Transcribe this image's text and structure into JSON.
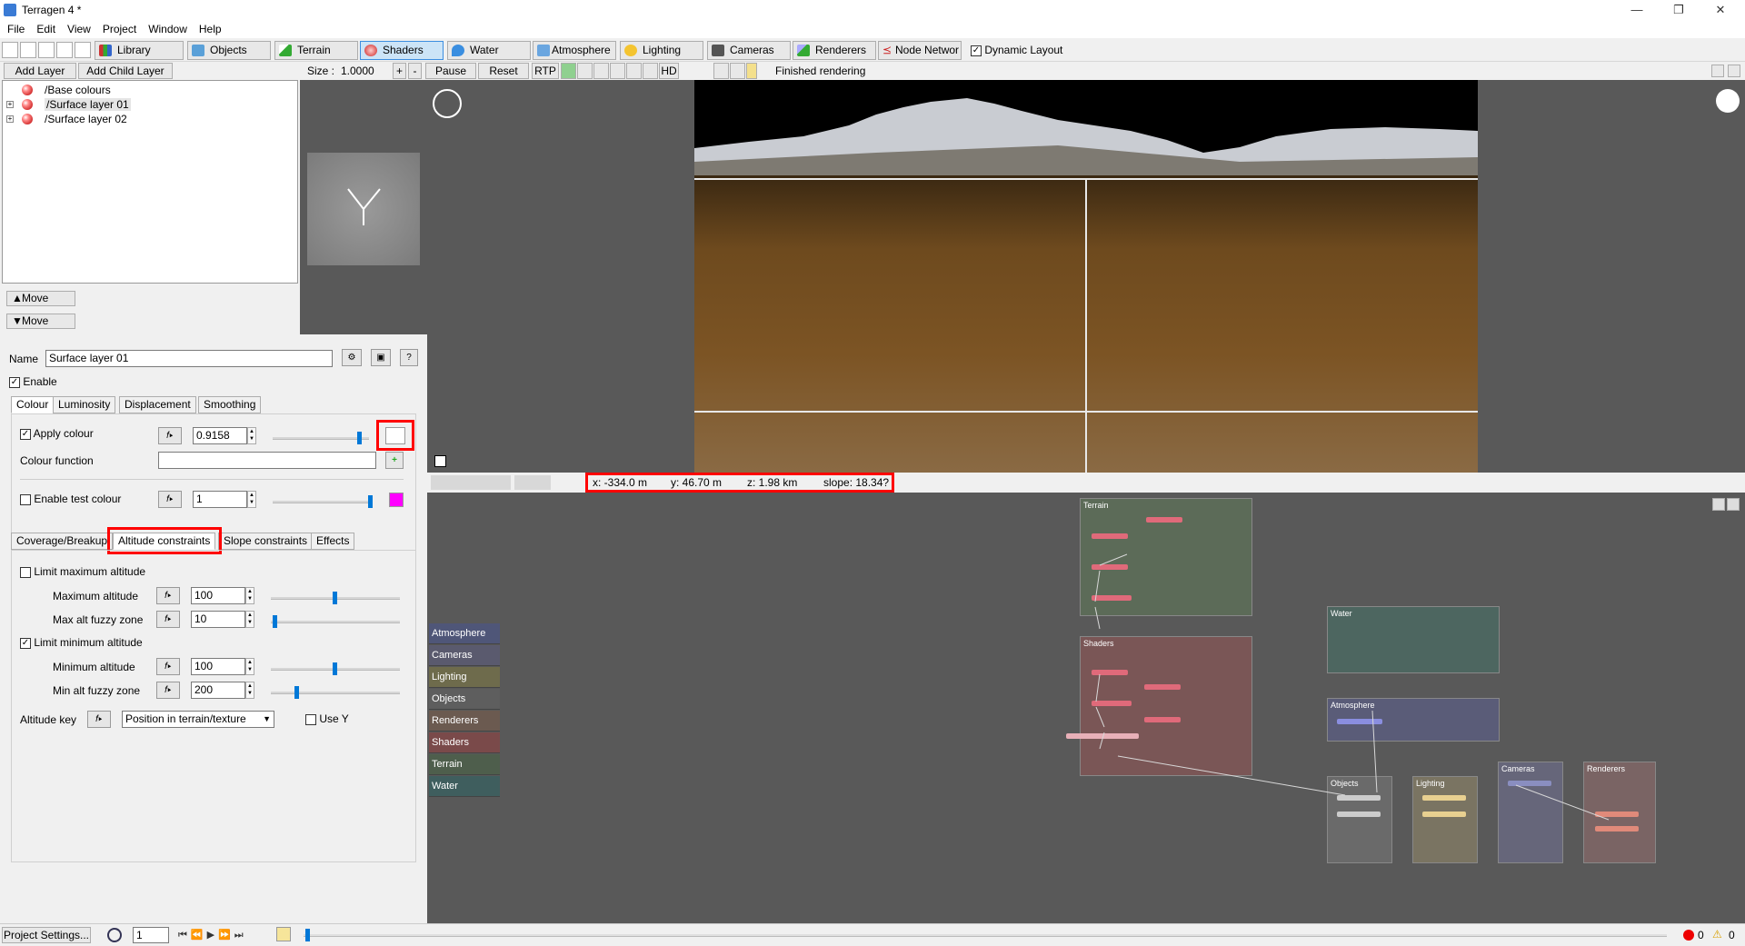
{
  "app": {
    "title": "Terragen 4 *"
  },
  "menu": [
    "File",
    "Edit",
    "View",
    "Project",
    "Window",
    "Help"
  ],
  "toolbar": {
    "buttons": [
      "Library",
      "Objects",
      "Terrain",
      "Shaders",
      "Water",
      "Atmosphere",
      "Lighting",
      "Cameras",
      "Renderers",
      "Node Networ"
    ],
    "dynamic_layout": "Dynamic Layout"
  },
  "layers": {
    "add_layer": "Add Layer",
    "add_child_layer": "Add Child Layer",
    "items": [
      "/Base colours",
      "/Surface layer 01",
      "/Surface layer 02"
    ],
    "move_up": "Move",
    "move_down": "Move"
  },
  "viewport_toolbar": {
    "size_label": "Size :",
    "size_value": "1.0000",
    "plus": "+",
    "minus": "-",
    "pause": "Pause",
    "reset": "Reset",
    "rtp": "RTP",
    "hd": "HD",
    "status": "Finished rendering"
  },
  "props": {
    "name_label": "Name",
    "name_value": "Surface layer 01",
    "enable": "Enable",
    "help": "?",
    "tabs": [
      "Colour",
      "Luminosity",
      "Displacement",
      "Smoothing"
    ],
    "apply_colour": "Apply colour",
    "apply_colour_value": "0.9158",
    "apply_colour_level": 0.92,
    "colour_function": "Colour function",
    "enable_test_colour": "Enable test colour",
    "test_colour_value": "1",
    "test_colour_level": 1.0,
    "test_swatch_color": "#ff00ff",
    "tabs2": [
      "Coverage/Breakup",
      "Altitude constraints",
      "Slope constraints",
      "Effects"
    ],
    "limit_max": "Limit maximum altitude",
    "max_alt_label": "Maximum altitude",
    "max_alt_value": "100",
    "max_fuzzy_label": "Max alt fuzzy zone",
    "max_fuzzy_value": "10",
    "limit_min": "Limit minimum altitude",
    "min_alt_label": "Minimum altitude",
    "min_alt_value": "100",
    "min_fuzzy_label": "Min alt fuzzy zone",
    "min_fuzzy_value": "200",
    "altitude_key": "Altitude key",
    "altitude_key_value": "Position in terrain/texture",
    "use_y": "Use Y"
  },
  "vp_status": {
    "x": "x: -334.0 m",
    "y": "y: 46.70 m",
    "z": "z: 1.98 km",
    "slope": "slope: 18.34?"
  },
  "nodenet": {
    "side_labels": [
      "Atmosphere",
      "Cameras",
      "Lighting",
      "Objects",
      "Renderers",
      "Shaders",
      "Terrain",
      "Water"
    ],
    "side_colors": [
      "#4f5678",
      "#5a5a6e",
      "#6e6b4c",
      "#5e5e5e",
      "#6b5a50",
      "#7a4a4a",
      "#4e5e4c",
      "#3f5e5e"
    ],
    "groups": [
      "Terrain",
      "Water",
      "Shaders",
      "Atmosphere",
      "Objects",
      "Lighting",
      "Cameras",
      "Renderers"
    ]
  },
  "bottom": {
    "project_settings": "Project Settings...",
    "frame": "1",
    "errors": "0",
    "warnings": "0"
  }
}
